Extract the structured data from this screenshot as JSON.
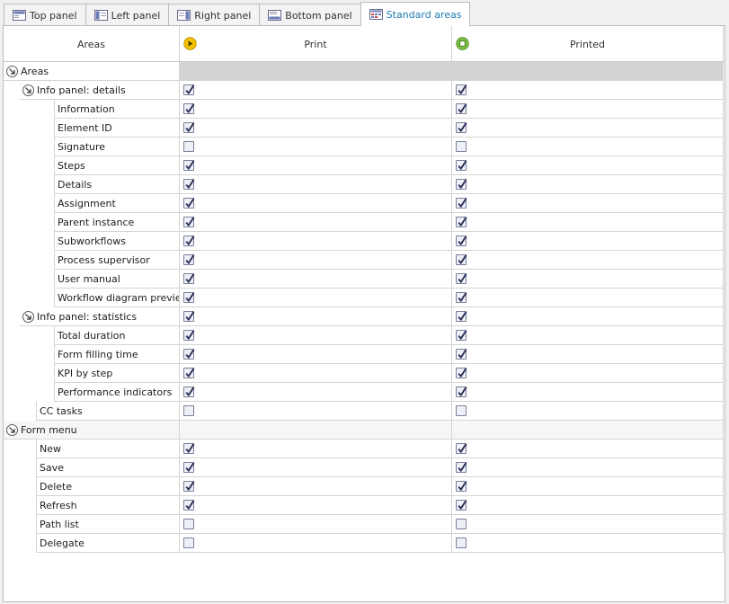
{
  "tabs": [
    {
      "label": "Top panel",
      "icon": "top-panel-icon",
      "active": false
    },
    {
      "label": "Left panel",
      "icon": "left-panel-icon",
      "active": false
    },
    {
      "label": "Right panel",
      "icon": "right-panel-icon",
      "active": false
    },
    {
      "label": "Bottom panel",
      "icon": "bottom-panel-icon",
      "active": false
    },
    {
      "label": "Standard areas",
      "icon": "standard-areas-icon",
      "active": true
    }
  ],
  "grid": {
    "headers": {
      "areas": "Areas",
      "print": "Print",
      "printed": "Printed"
    },
    "header_icons": {
      "print": "play-icon",
      "printed": "stop-icon"
    },
    "rows": [
      {
        "label": "Areas",
        "level": 0,
        "group": true,
        "print": null,
        "printed": null,
        "shaded": true
      },
      {
        "label": "Info panel: details",
        "level": 1,
        "group": true,
        "print": true,
        "printed": true
      },
      {
        "label": "Information",
        "level": 2,
        "print": true,
        "printed": true
      },
      {
        "label": "Element ID",
        "level": 2,
        "print": true,
        "printed": true
      },
      {
        "label": "Signature",
        "level": 2,
        "print": false,
        "printed": false
      },
      {
        "label": "Steps",
        "level": 2,
        "print": true,
        "printed": true
      },
      {
        "label": "Details",
        "level": 2,
        "print": true,
        "printed": true
      },
      {
        "label": "Assignment",
        "level": 2,
        "print": true,
        "printed": true
      },
      {
        "label": "Parent instance",
        "level": 2,
        "print": true,
        "printed": true
      },
      {
        "label": "Subworkflows",
        "level": 2,
        "print": true,
        "printed": true
      },
      {
        "label": "Process supervisor",
        "level": 2,
        "print": true,
        "printed": true
      },
      {
        "label": "User manual",
        "level": 2,
        "print": true,
        "printed": true
      },
      {
        "label": "Workflow diagram preview",
        "level": 2,
        "print": true,
        "printed": true
      },
      {
        "label": "Info panel: statistics",
        "level": 1,
        "group": true,
        "print": true,
        "printed": true
      },
      {
        "label": "Total duration",
        "level": 2,
        "print": true,
        "printed": true
      },
      {
        "label": "Form filling time",
        "level": 2,
        "print": true,
        "printed": true
      },
      {
        "label": "KPI by step",
        "level": 2,
        "print": true,
        "printed": true
      },
      {
        "label": "Performance indicators",
        "level": 2,
        "print": true,
        "printed": true
      },
      {
        "label": "CC tasks",
        "level": 1,
        "print": false,
        "printed": false
      },
      {
        "label": "Form menu",
        "level": 0,
        "group": true,
        "print": null,
        "printed": null,
        "light": true
      },
      {
        "label": "New",
        "level": 1,
        "print": true,
        "printed": true
      },
      {
        "label": "Save",
        "level": 1,
        "print": true,
        "printed": true
      },
      {
        "label": "Delete",
        "level": 1,
        "print": true,
        "printed": true
      },
      {
        "label": "Refresh",
        "level": 1,
        "print": true,
        "printed": true
      },
      {
        "label": "Path list",
        "level": 1,
        "print": false,
        "printed": false
      },
      {
        "label": "Delegate",
        "level": 1,
        "print": false,
        "printed": false
      }
    ]
  },
  "colors": {
    "active_tab_text": "#1e78b4",
    "play_icon": "#f2c200",
    "stop_icon": "#7cc142",
    "check": "#2b2f55"
  }
}
